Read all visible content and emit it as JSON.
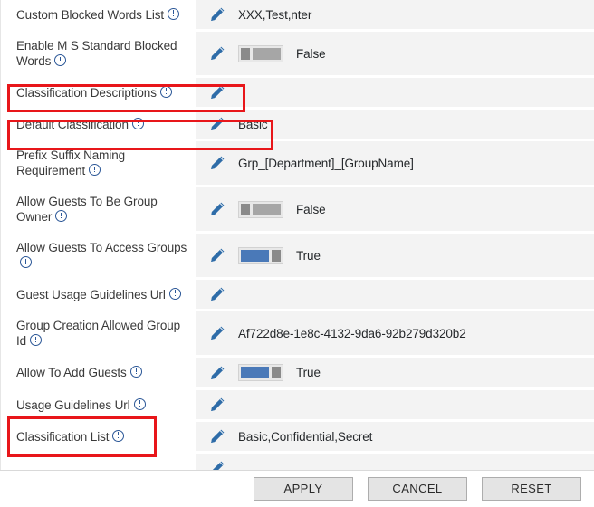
{
  "settings": {
    "rows": [
      {
        "label": "Custom Blocked Words List",
        "has_info": true,
        "control": "text",
        "value": "XXX,Test,nter",
        "highlight": false
      },
      {
        "label": "Enable M S Standard Blocked Words",
        "has_info": true,
        "control": "toggle",
        "toggle_state": "off",
        "value": "False",
        "highlight": false
      },
      {
        "label": "Classification Descriptions",
        "has_info": true,
        "control": "text",
        "value": "",
        "highlight": true
      },
      {
        "label": "Default Classification",
        "has_info": true,
        "control": "text",
        "value": "Basic",
        "highlight": true
      },
      {
        "label": "Prefix Suffix Naming Requirement",
        "has_info": true,
        "control": "text",
        "value": "Grp_[Department]_[GroupName]",
        "highlight": false
      },
      {
        "label": "Allow Guests To Be Group Owner",
        "has_info": true,
        "control": "toggle",
        "toggle_state": "off",
        "value": "False",
        "highlight": false
      },
      {
        "label": "Allow Guests To Access Groups",
        "has_info": true,
        "control": "toggle",
        "toggle_state": "on",
        "value": "True",
        "highlight": false
      },
      {
        "label": "Guest Usage Guidelines Url",
        "has_info": true,
        "control": "text",
        "value": "",
        "highlight": false
      },
      {
        "label": "Group Creation Allowed Group Id",
        "has_info": true,
        "control": "text",
        "value": "Af722d8e-1e8c-4132-9da6-92b279d320b2",
        "highlight": false
      },
      {
        "label": "Allow To Add Guests",
        "has_info": true,
        "control": "toggle",
        "toggle_state": "on",
        "value": "True",
        "highlight": false
      },
      {
        "label": "Usage Guidelines Url",
        "has_info": true,
        "control": "text",
        "value": "",
        "highlight": false
      },
      {
        "label": "Classification List",
        "has_info": true,
        "control": "text",
        "value": "Basic,Confidential,Secret",
        "highlight": true
      },
      {
        "label": "",
        "has_info": false,
        "control": "text",
        "value": "",
        "highlight": false
      }
    ],
    "edit_icon_name": "pencil-icon",
    "info_icon_name": "info-icon"
  },
  "footer": {
    "apply_label": "APPLY",
    "cancel_label": "CANCEL",
    "reset_label": "RESET"
  },
  "colors": {
    "accent_blue": "#2b5797",
    "toggle_on": "#4a79b8",
    "toggle_off": "#a6a6a6",
    "highlight_red": "#e8161a",
    "row_background": "#f3f3f3",
    "button_background": "#e4e4e4"
  }
}
